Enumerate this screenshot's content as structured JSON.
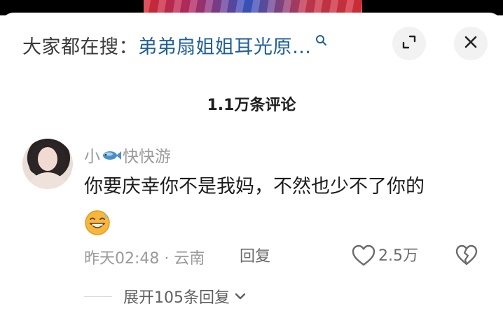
{
  "search": {
    "prefix": "大家都在搜：",
    "query": "弟弟扇姐姐耳光原…",
    "icon": "search-icon"
  },
  "header": {
    "expand_icon": "expand-icon",
    "close_icon": "close-icon"
  },
  "comments_header": {
    "count_label": "1.1万条评论"
  },
  "comment": {
    "avatar": "avatar",
    "username_prefix": "小",
    "username_icon": "fish-icon",
    "username_suffix": "快快游",
    "text": "你要庆幸你不是我妈，不然也少不了你的",
    "emoji": "grinning-sweat-emoji",
    "time_location": "昨天02:48 · 云南",
    "reply_label": "回复",
    "like_count": "2.5万",
    "like_icon": "heart-outline-icon",
    "dislike_icon": "broken-heart-icon"
  },
  "replies": {
    "expand_label": "展开105条回复",
    "expand_icon": "chevron-down-icon"
  },
  "colors": {
    "accent_link": "#1f5f96",
    "text_primary": "#1c1c1c",
    "text_secondary": "#9a9a9a"
  }
}
